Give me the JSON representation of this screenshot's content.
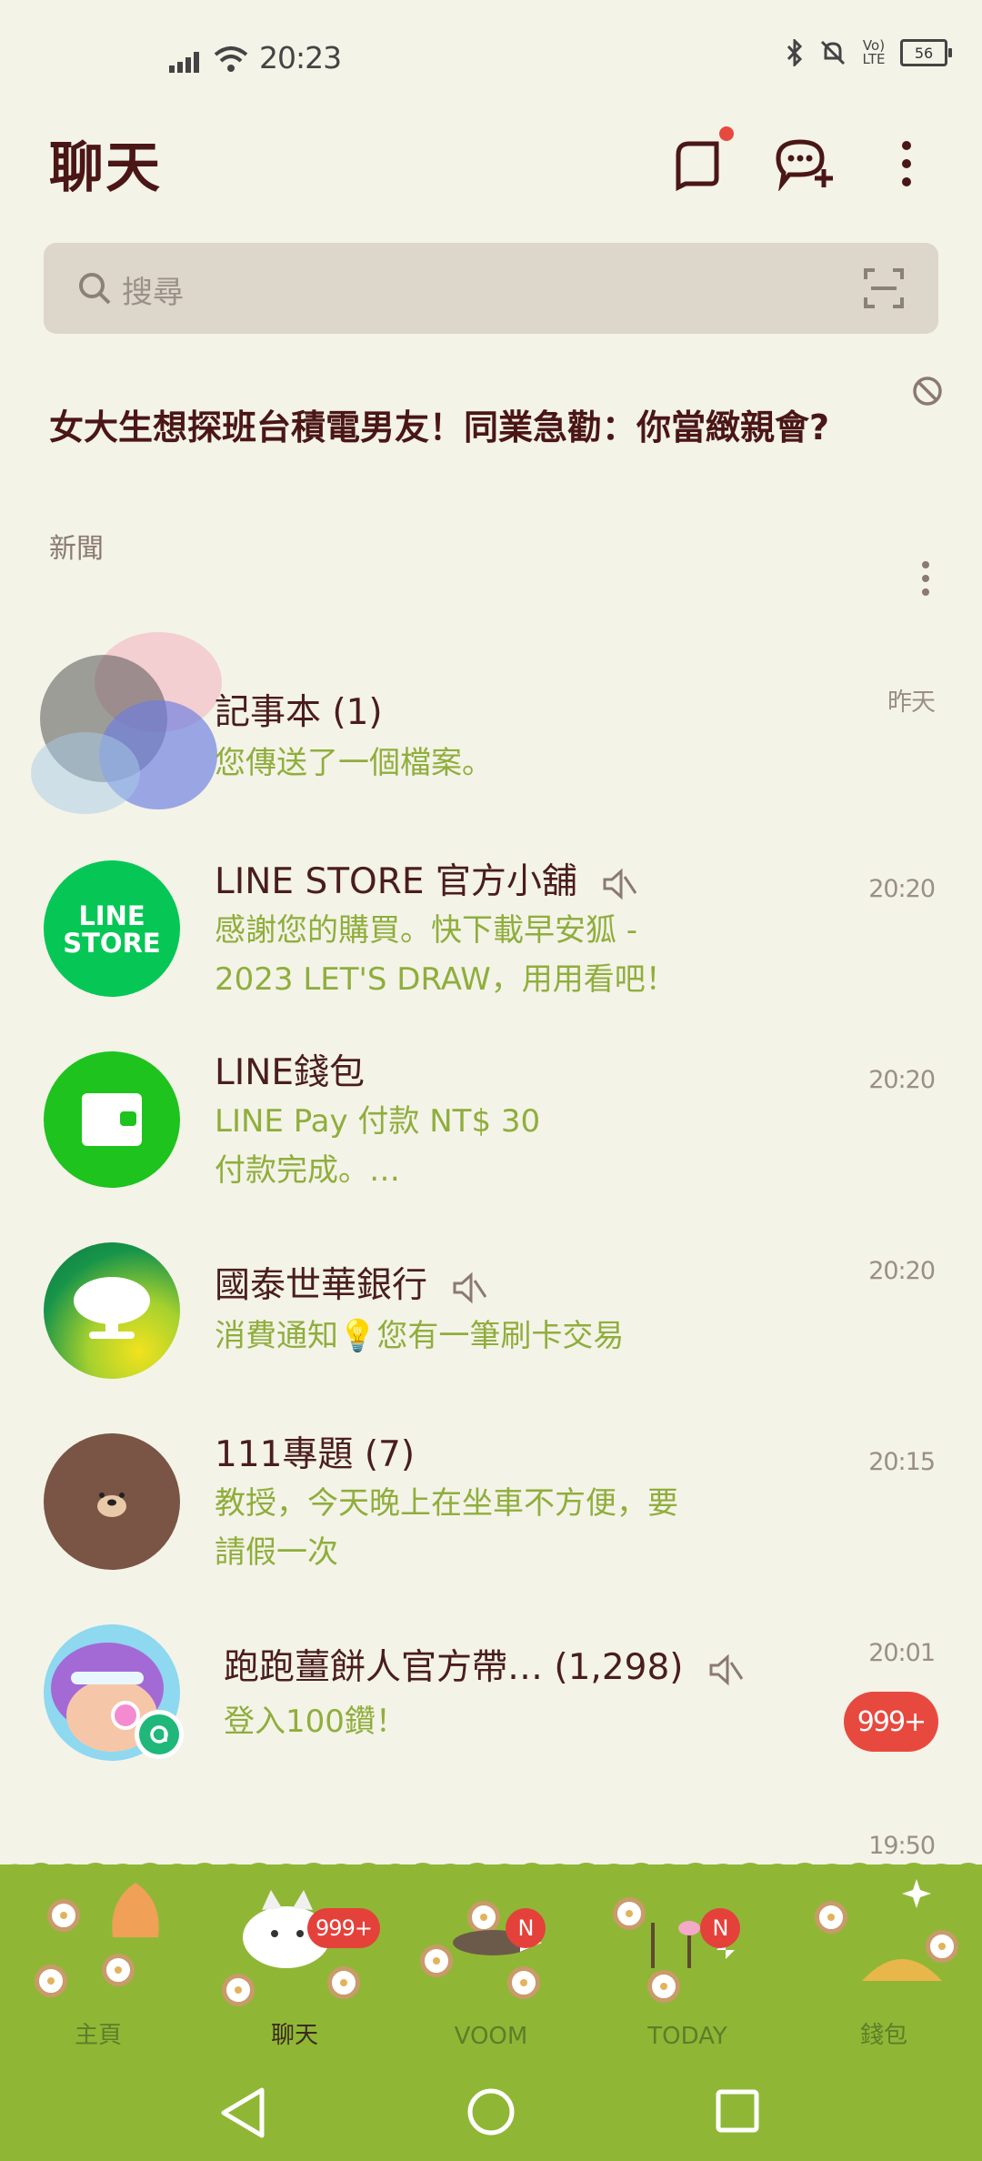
{
  "status": {
    "time": "20:23",
    "battery": "56",
    "network_label": "Vo) LTE"
  },
  "header": {
    "title": "聊天"
  },
  "search": {
    "placeholder": "搜尋"
  },
  "news": {
    "headline": "女大生想探班台積電男友！同業急勸：你當緻親會?",
    "source": "新聞"
  },
  "chats": [
    {
      "name": "記事本 (1)",
      "preview": "您傳送了一個檔案。",
      "time": "昨天",
      "muted": false
    },
    {
      "name": "LINE STORE 官方小舖",
      "preview_line1": "感謝您的購買。快下載早安狐 -",
      "preview_line2": "2023 LET'S DRAW，用用看吧！",
      "time": "20:20",
      "muted": true,
      "avatar_text_1": "LINE",
      "avatar_text_2": "STORE"
    },
    {
      "name": "LINE錢包",
      "preview_line1": "LINE Pay 付款 NT$ 30",
      "preview_line2": "付款完成。…",
      "time": "20:20",
      "muted": false
    },
    {
      "name": "國泰世華銀行",
      "preview": "消費通知💡您有一筆刷卡交易",
      "time": "20:20",
      "muted": true
    },
    {
      "name": "111專題 (7)",
      "preview_line1": "教授，今天晚上在坐車不方便，要",
      "preview_line2": "請假一次",
      "time": "20:15",
      "muted": false
    },
    {
      "name": "跑跑薑餅人官方帶… (1,298)",
      "preview": "登入100鑽！",
      "time": "20:01",
      "muted": true,
      "unread": "999+"
    },
    {
      "time": "19:50"
    }
  ],
  "nav": {
    "items": [
      {
        "label": "主頁"
      },
      {
        "label": "聊天",
        "badge": "999+"
      },
      {
        "label": "VOOM",
        "badge": "N"
      },
      {
        "label": "TODAY",
        "badge": "N"
      },
      {
        "label": "錢包"
      }
    ]
  },
  "colors": {
    "background": "#f4f3e8",
    "accent_green": "#8fb735",
    "preview_text": "#8fae3c",
    "badge_red": "#e8493f"
  }
}
